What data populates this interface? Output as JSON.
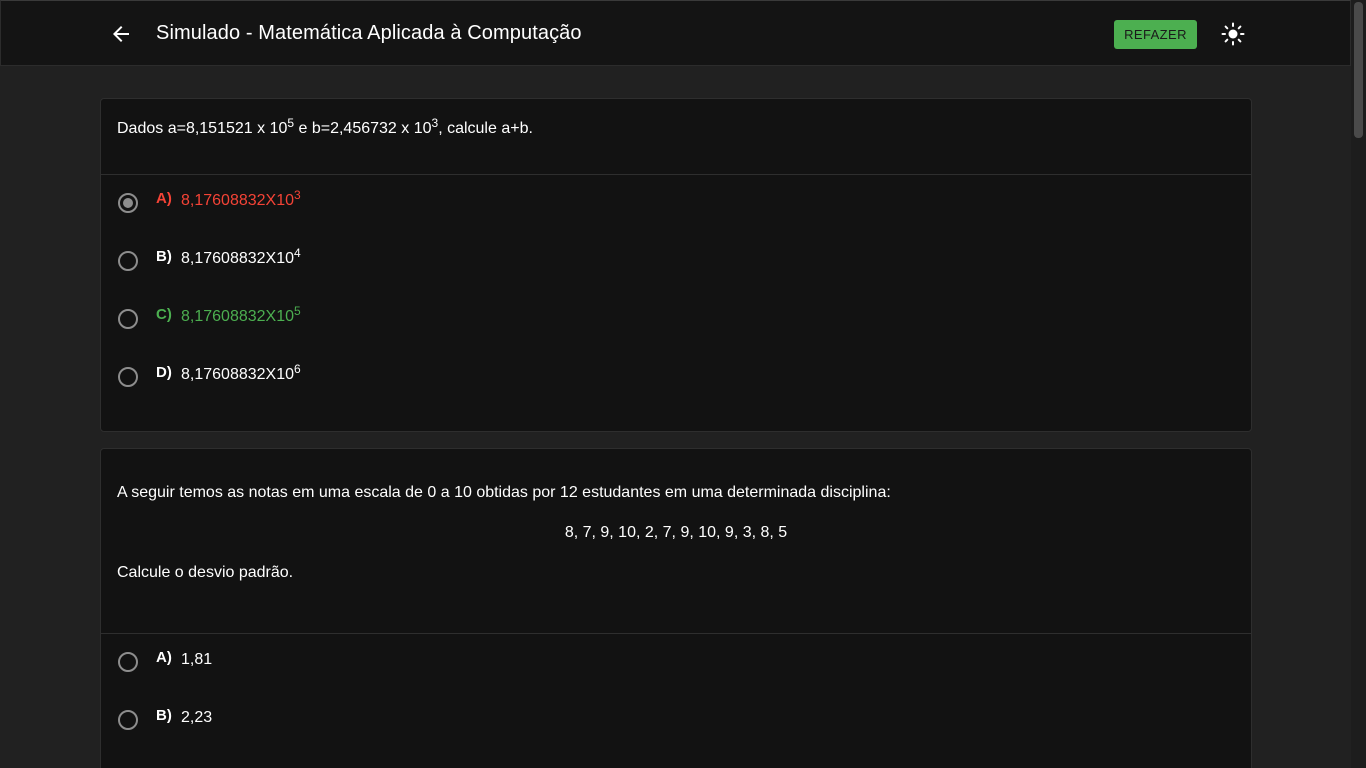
{
  "header": {
    "title": "Simulado - Matemática Aplicada à Computação",
    "redo_label": "REFAZER",
    "back_icon": "arrow-left-icon",
    "theme_icon": "sun-icon"
  },
  "colors": {
    "background": "#212121",
    "card": "#121212",
    "appbar": "#141414",
    "accent_green": "#4caf50",
    "error_red": "#f44336"
  },
  "questions": [
    {
      "text_parts": {
        "p1": "Dados a=8,151521 x 10",
        "e1": "5",
        "p2": " e b=2,456732 x 10",
        "e2": "3",
        "p3": ", calcule a+b."
      },
      "options": [
        {
          "letter": "A)",
          "base": "8,17608832X10",
          "exp": "3",
          "state": "selected-wrong"
        },
        {
          "letter": "B)",
          "base": "8,17608832X10",
          "exp": "4",
          "state": "none"
        },
        {
          "letter": "C)",
          "base": "8,17608832X10",
          "exp": "5",
          "state": "correct"
        },
        {
          "letter": "D)",
          "base": "8,17608832X10",
          "exp": "6",
          "state": "none"
        }
      ]
    },
    {
      "intro": "A seguir temos as notas em uma escala de 0 a 10 obtidas por 12 estudantes em uma determinada disciplina:",
      "grades": "8, 7, 9, 10, 2, 7, 9, 10, 9, 3, 8, 5",
      "prompt": "Calcule o desvio padrão.",
      "options": [
        {
          "letter": "A)",
          "value": "1,81"
        },
        {
          "letter": "B)",
          "value": "2,23"
        }
      ]
    }
  ]
}
